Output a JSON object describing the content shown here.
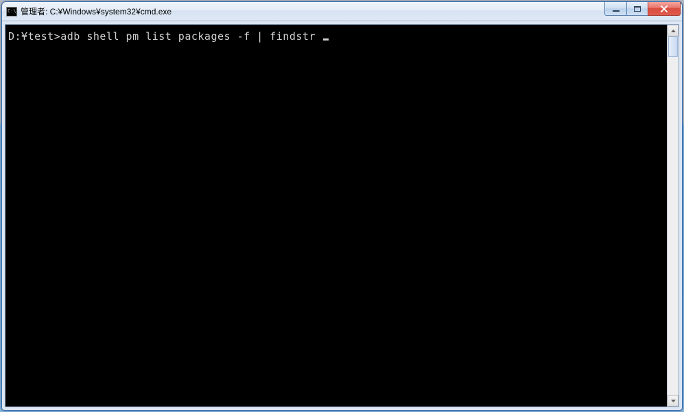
{
  "window": {
    "title": "管理者: C:¥Windows¥system32¥cmd.exe",
    "icon_glyph": "C:\\"
  },
  "terminal": {
    "prompt": "D:¥test>",
    "command": "adb shell pm list packages -f | findstr "
  }
}
